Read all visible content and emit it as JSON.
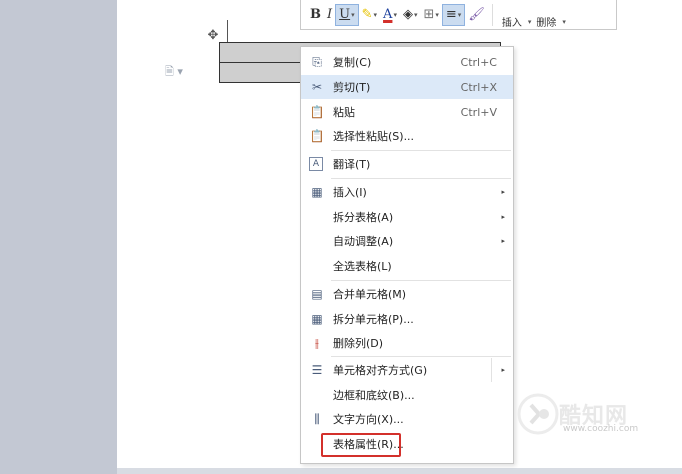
{
  "mini_toolbar": {
    "bold": "B",
    "italic": "I",
    "underline": "U",
    "font_color": "A",
    "insert_label": "插入",
    "delete_label": "删除"
  },
  "context_menu": {
    "items": [
      {
        "label": "复制(C)",
        "shortcut": "Ctrl+C",
        "icon": "copy-icon"
      },
      {
        "label": "剪切(T)",
        "shortcut": "Ctrl+X",
        "icon": "scissors-icon"
      },
      {
        "label": "粘贴",
        "shortcut": "Ctrl+V",
        "icon": "paste-icon"
      },
      {
        "label": "选择性粘贴(S)...",
        "icon": "paste-special-icon"
      },
      {
        "label": "翻译(T)",
        "icon": "translate-icon"
      },
      {
        "label": "插入(I)",
        "icon": "table-insert-icon"
      },
      {
        "label": "拆分表格(A)"
      },
      {
        "label": "自动调整(A)"
      },
      {
        "label": "全选表格(L)"
      },
      {
        "label": "合并单元格(M)",
        "icon": "merge-cells-icon"
      },
      {
        "label": "拆分单元格(P)...",
        "icon": "split-cells-icon"
      },
      {
        "label": "删除列(D)",
        "icon": "delete-column-icon"
      },
      {
        "label": "单元格对齐方式(G)",
        "icon": "cell-align-icon"
      },
      {
        "label": "边框和底纹(B)..."
      },
      {
        "label": "文字方向(X)...",
        "icon": "text-direction-icon"
      },
      {
        "label": "表格属性(R)..."
      }
    ]
  },
  "watermark": {
    "title": "酷知网",
    "url": "www.coozhi.com"
  },
  "colors": {
    "highlight_border": "#d3302b",
    "hover_bg": "#dce9f8",
    "gutter": "#c3c8d3"
  }
}
